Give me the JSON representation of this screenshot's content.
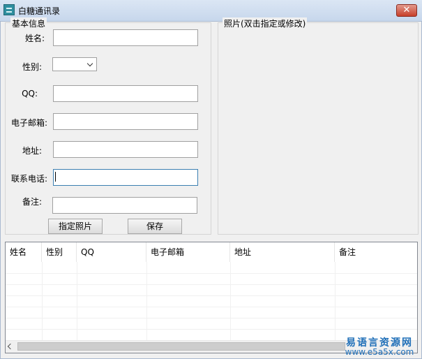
{
  "window": {
    "title": "白糖通讯录",
    "close_label": "✕"
  },
  "basic_info": {
    "title": "基本信息",
    "labels": {
      "name": "姓名:",
      "gender": "性别:",
      "qq": "QQ:",
      "email": "电子邮箱:",
      "address": "地址:",
      "phone": "联系电话:",
      "remark": "备注:"
    },
    "values": {
      "name": "",
      "gender": "",
      "qq": "",
      "email": "",
      "address": "",
      "phone": "",
      "remark": ""
    },
    "buttons": {
      "set_photo": "指定照片",
      "save": "保存"
    }
  },
  "photo": {
    "title": "照片(双击指定或修改)"
  },
  "table": {
    "columns": [
      "姓名",
      "性别",
      "QQ",
      "电子邮箱",
      "地址",
      "备注"
    ]
  },
  "watermark": {
    "top": "易语言资源网",
    "bottom": "www.e5a5x.com"
  },
  "colors": {
    "accent": "#3c7fb1",
    "watermark": "#1f6fb8",
    "close": "#c7402b"
  }
}
